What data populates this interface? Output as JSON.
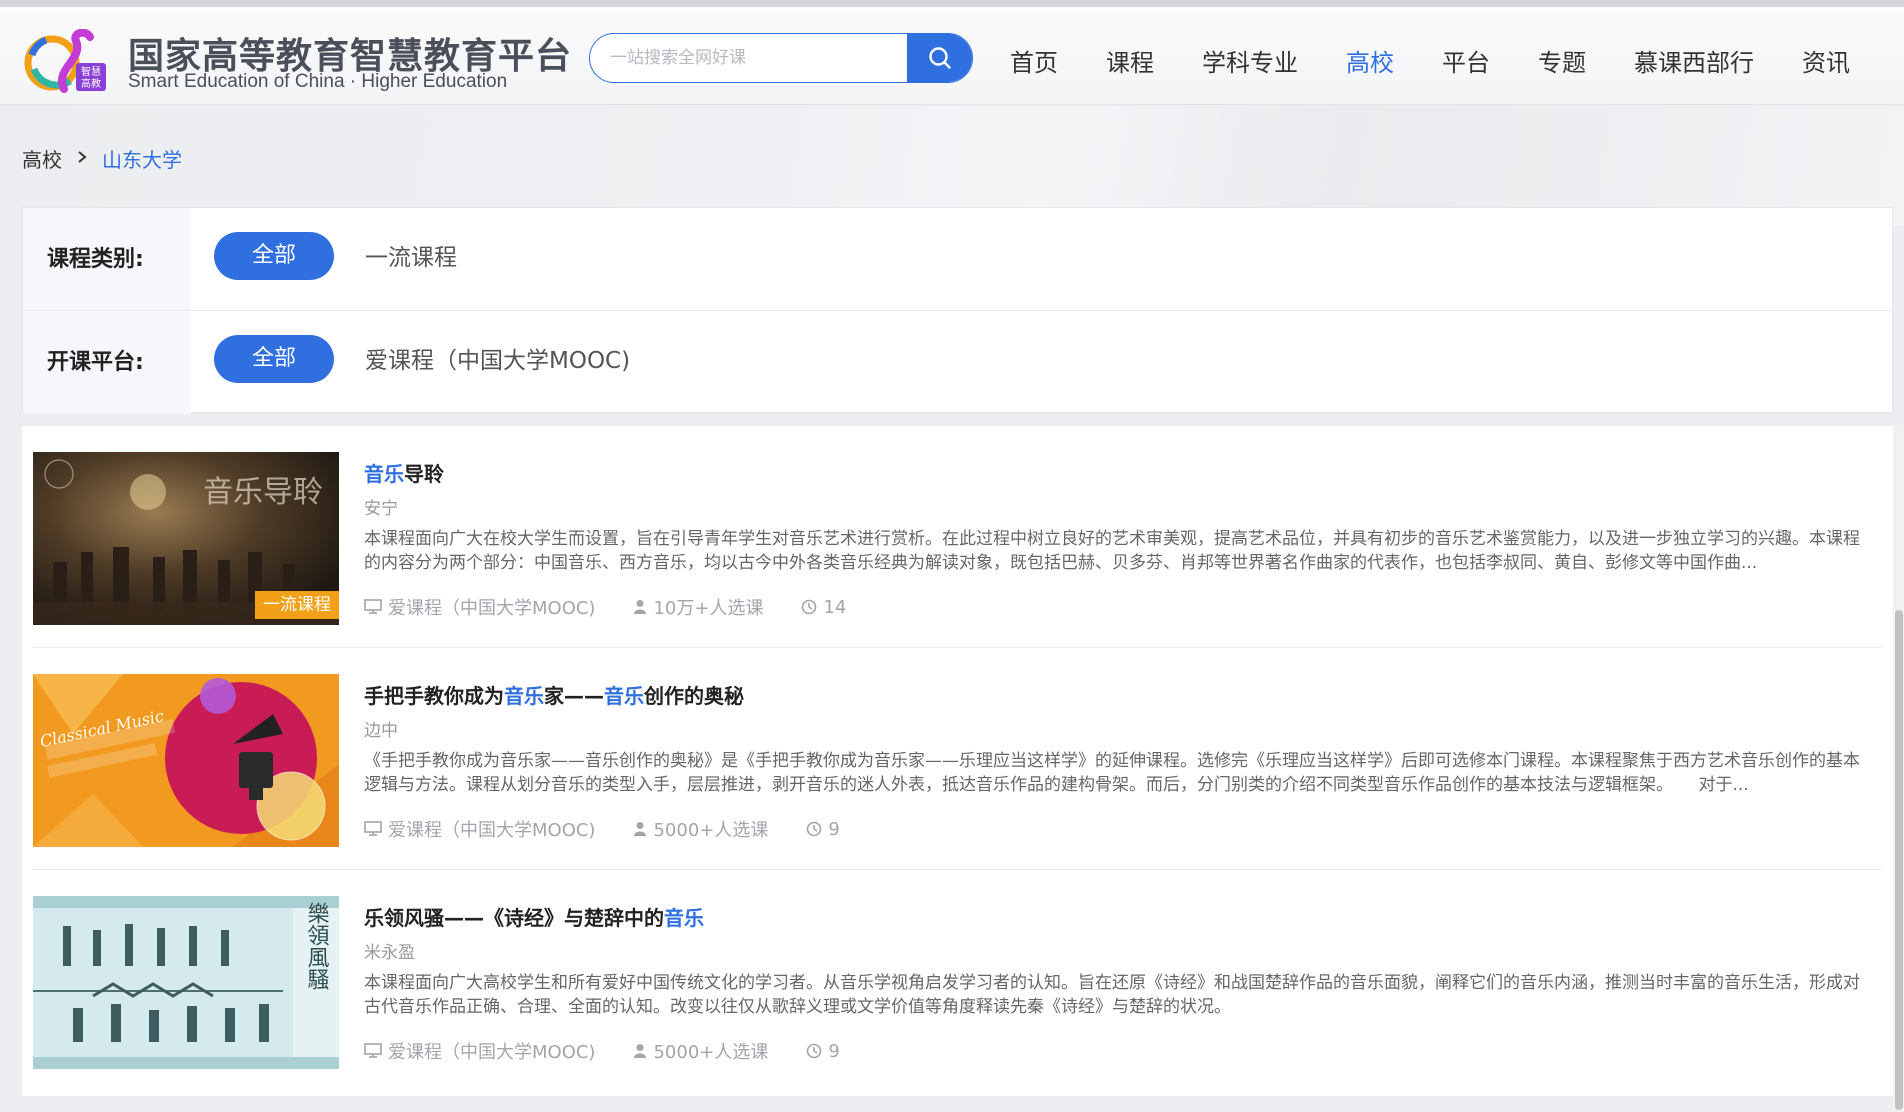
{
  "header": {
    "logo_cn": "国家高等教育智慧教育平台",
    "logo_en": "Smart Education of China · Higher Education",
    "search_placeholder": "一站搜索全网好课",
    "nav": [
      {
        "label": "首页",
        "active": false
      },
      {
        "label": "课程",
        "active": false
      },
      {
        "label": "学科专业",
        "active": false
      },
      {
        "label": "高校",
        "active": true
      },
      {
        "label": "平台",
        "active": false
      },
      {
        "label": "专题",
        "active": false
      },
      {
        "label": "慕课西部行",
        "active": false
      },
      {
        "label": "资讯",
        "active": false
      }
    ]
  },
  "breadcrumb": {
    "root": "高校",
    "current": "山东大学"
  },
  "filters": {
    "category": {
      "label": "课程类别:",
      "all": "全部",
      "option": "一流课程"
    },
    "platform": {
      "label": "开课平台:",
      "all": "全部",
      "option": "爱课程（中国大学MOOC)"
    }
  },
  "courses": [
    {
      "title_parts": [
        {
          "text": "音乐",
          "hl": true
        },
        {
          "text": "导聆",
          "hl": false
        }
      ],
      "teacher": "安宁",
      "description": "本课程面向广大在校大学生而设置，旨在引导青年学生对音乐艺术进行赏析。在此过程中树立良好的艺术审美观，提高艺术品位，并具有初步的音乐艺术鉴赏能力，以及进一步独立学习的兴趣。本课程的内容分为两个部分：中国音乐、西方音乐，均以古今中外各类音乐经典为解读对象，既包括巴赫、贝多芬、肖邦等世界著名作曲家的代表作，也包括李叔同、黄自、彭修文等中国作曲...",
      "platform": "爱课程（中国大学MOOC)",
      "enrolled": "10万+人选课",
      "sessions": "14",
      "badge": "一流课程",
      "thumb_text": "音乐导聆"
    },
    {
      "title_parts": [
        {
          "text": "手把手教你成为",
          "hl": false
        },
        {
          "text": "音乐",
          "hl": true
        },
        {
          "text": "家——",
          "hl": false
        },
        {
          "text": "音乐",
          "hl": true
        },
        {
          "text": "创作的奥秘",
          "hl": false
        }
      ],
      "teacher": "边中",
      "description": "《手把手教你成为音乐家——音乐创作的奥秘》是《手把手教你成为音乐家——乐理应当这样学》的延伸课程。选修完《乐理应当这样学》后即可选修本门课程。本课程聚焦于西方艺术音乐创作的基本逻辑与方法。课程从划分音乐的类型入手，层层推进，剥开音乐的迷人外表，抵达音乐作品的建构骨架。而后，分门别类的介绍不同类型音乐作品创作的基本技法与逻辑框架。　　对于...",
      "platform": "爱课程（中国大学MOOC)",
      "enrolled": "5000+人选课",
      "sessions": "9",
      "badge": "",
      "thumb_text": "Classical Music"
    },
    {
      "title_parts": [
        {
          "text": "乐领风骚——《诗经》与楚辞中的",
          "hl": false
        },
        {
          "text": "音乐",
          "hl": true
        }
      ],
      "teacher": "米永盈",
      "description": "本课程面向广大高校学生和所有爱好中国传统文化的学习者。从音乐学视角启发学习者的认知。旨在还原《诗经》和战国楚辞作品的音乐面貌，阐释它们的音乐内涵，推测当时丰富的音乐生活，形成对古代音乐作品正确、合理、全面的认知。改变以往仅从歌辞义理或文学价值等角度释读先秦《诗经》与楚辞的状况。",
      "platform": "爱课程（中国大学MOOC)",
      "enrolled": "5000+人选课",
      "sessions": "9",
      "badge": "",
      "thumb_text": "樂領風騷"
    }
  ],
  "colors": {
    "accent": "#2f6fe0",
    "badge": "#f3a019"
  }
}
